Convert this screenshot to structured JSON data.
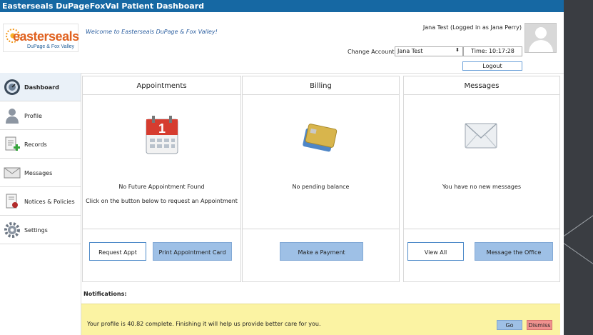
{
  "window": {
    "title": "Easterseals DuPageFoxVal Patient Dashboard"
  },
  "header": {
    "logo_text": "easterseals",
    "logo_sub": "DuPage & Fox Valley",
    "welcome": "Welcome to Easterseals DuPage & Fox Valley!",
    "user_line": "Jana Test (Logged in as Jana Perry)",
    "change_account_label": "Change Account",
    "account_selected": "Jana Test",
    "time": "Time: 10:17:28",
    "logout_label": "Logout"
  },
  "sidebar": {
    "items": [
      {
        "label": "Dashboard",
        "icon": "dashboard-icon"
      },
      {
        "label": "Profile",
        "icon": "person-icon"
      },
      {
        "label": "Records",
        "icon": "records-add-icon"
      },
      {
        "label": "Messages",
        "icon": "envelope-icon"
      },
      {
        "label": "Notices & Policies",
        "icon": "notice-icon"
      },
      {
        "label": "Settings",
        "icon": "gear-icon"
      }
    ]
  },
  "panels": {
    "appointments": {
      "title": "Appointments",
      "icon": "calendar-icon",
      "calendar_day": "1",
      "message": "No Future Appointment Found",
      "hint": "Click on the button below to request an Appointment",
      "request_label": "Request Appt",
      "print_label": "Print Appointment Card"
    },
    "billing": {
      "title": "Billing",
      "icon": "credit-cards-icon",
      "message": "No pending balance",
      "pay_label": "Make a Payment"
    },
    "messages": {
      "title": "Messages",
      "icon": "envelope-icon",
      "message": "You have no new messages",
      "view_all_label": "View All",
      "message_office_label": "Message the Office"
    }
  },
  "notifications": {
    "label": "Notifications:",
    "text": "Your profile is 40.82 complete. Finishing it will help us provide better care for you.",
    "go_label": "Go",
    "dismiss_label": "Dismiss"
  },
  "colors": {
    "titlebar": "#1668a3",
    "brand_orange": "#e0611f",
    "brand_blue": "#1f5e98",
    "button_fill": "#9ec0e6",
    "notification_bg": "#fbf3a3",
    "dismiss": "#f0928f"
  }
}
